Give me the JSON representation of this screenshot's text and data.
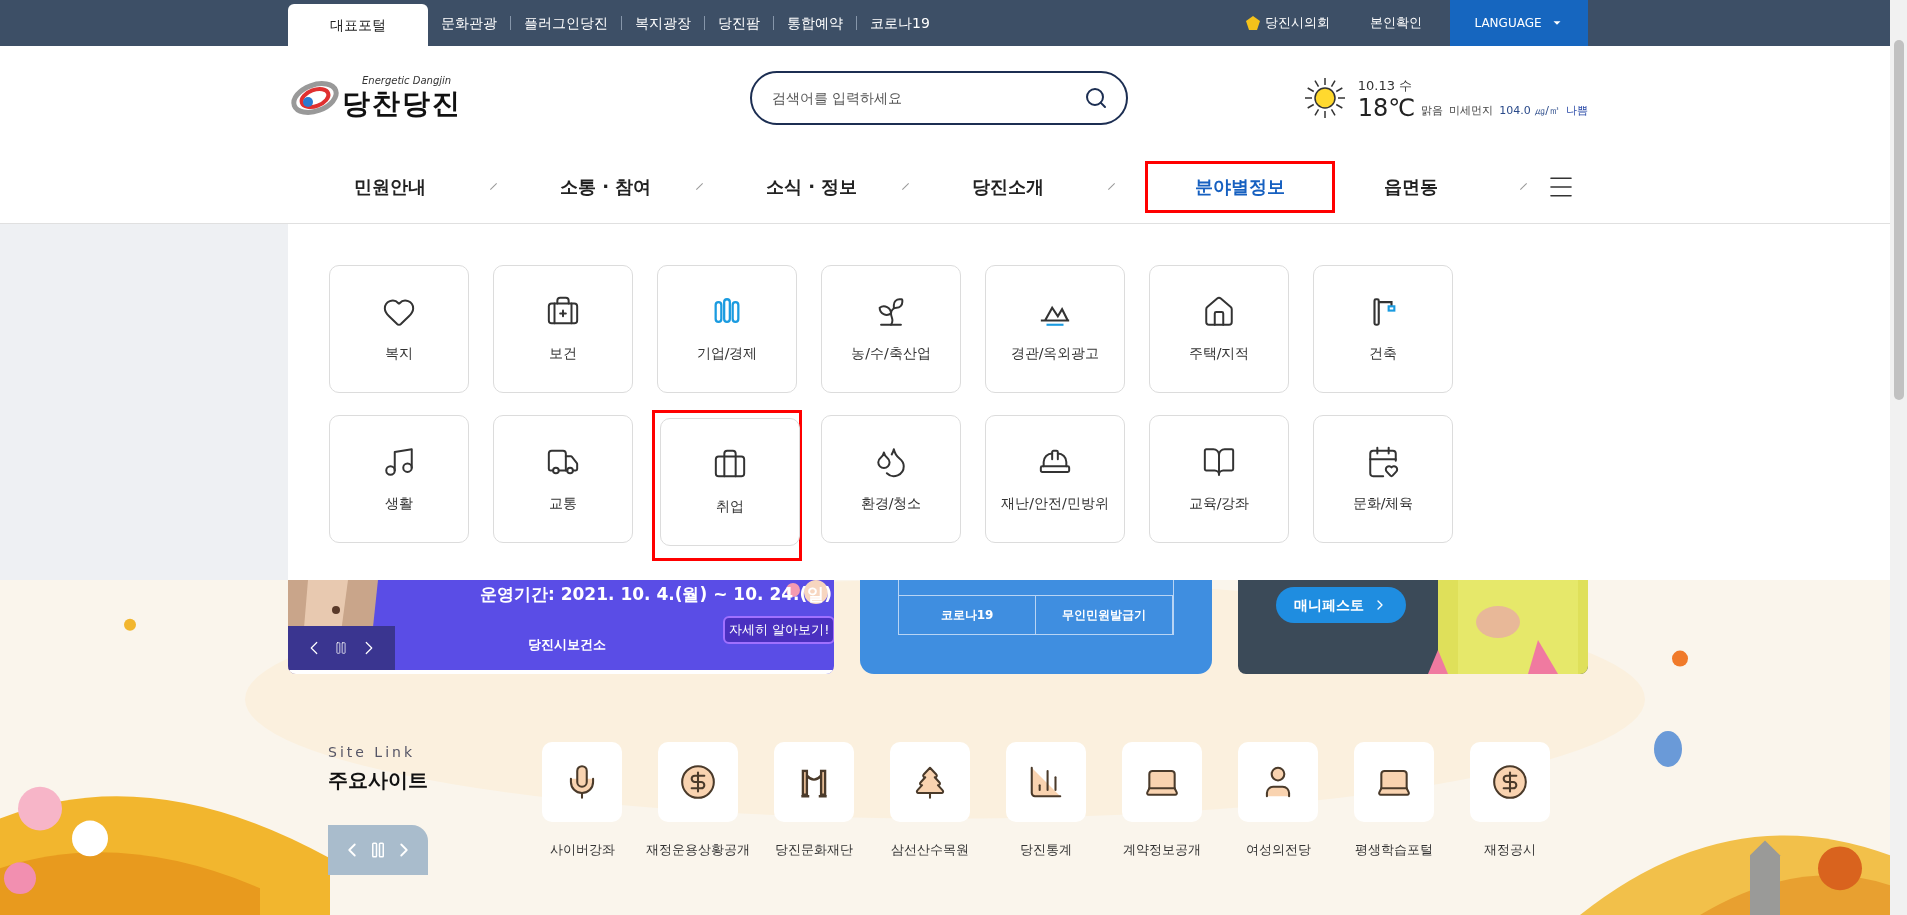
{
  "top_bar": {
    "tabs": [
      {
        "label": "대표포털",
        "selected": true
      },
      {
        "label": "문화관광",
        "selected": false
      },
      {
        "label": "플러그인당진",
        "selected": false
      },
      {
        "label": "복지광장",
        "selected": false
      },
      {
        "label": "당진팜",
        "selected": false
      },
      {
        "label": "통합예약",
        "selected": false
      },
      {
        "label": "코로나19",
        "selected": false
      }
    ],
    "council": "당진시의회",
    "verify": "본인확인",
    "language": "LANGUAGE"
  },
  "header": {
    "logo_tagline": "Energetic Dangjin",
    "logo_text": "당찬당진",
    "search": {
      "placeholder": "검색어를 입력하세요"
    },
    "weather": {
      "date": "10.13 수",
      "temperature": "18℃",
      "condition": "맑음",
      "dust_label": "미세먼지",
      "dust_value": "104.0 ㎍/㎥",
      "dust_grade": "나쁨"
    }
  },
  "nav": [
    {
      "label": "민원안내",
      "selected": false
    },
    {
      "label": "소통 · 참여",
      "selected": false
    },
    {
      "label": "소식 · 정보",
      "selected": false
    },
    {
      "label": "당진소개",
      "selected": false
    },
    {
      "label": "분야별정보",
      "selected": true
    },
    {
      "label": "읍면동",
      "selected": false
    }
  ],
  "mega_menu": [
    {
      "label": "복지",
      "selected": false
    },
    {
      "label": "보건",
      "selected": false
    },
    {
      "label": "기업/경제",
      "selected": false
    },
    {
      "label": "농/수/축산업",
      "selected": false
    },
    {
      "label": "경관/옥외광고",
      "selected": false
    },
    {
      "label": "주택/지적",
      "selected": false
    },
    {
      "label": "건축",
      "selected": false
    },
    {
      "label": "생활",
      "selected": false
    },
    {
      "label": "교통",
      "selected": false
    },
    {
      "label": "취업",
      "selected": true
    },
    {
      "label": "환경/청소",
      "selected": false
    },
    {
      "label": "재난/안전/민방위",
      "selected": false
    },
    {
      "label": "교육/강좌",
      "selected": false
    },
    {
      "label": "문화/체육",
      "selected": false
    }
  ],
  "banners": {
    "event": {
      "period": "운영기간: 2021. 10. 4.(월) ~ 10. 24.(일)",
      "org": "당진시보건소",
      "more": "자세히 알아보기!"
    },
    "quick_table": [
      "코로나19",
      "무인민원발급기"
    ],
    "manifesto": "매니페스토"
  },
  "site_links": {
    "eyebrow": "Site Link",
    "title": "주요사이트",
    "items": [
      "사이버강좌",
      "재정운용상황공개",
      "당진문화재단",
      "삼선산수목원",
      "당진통계",
      "계약정보공개",
      "여성의전당",
      "평생학습포털",
      "재정공시"
    ]
  }
}
